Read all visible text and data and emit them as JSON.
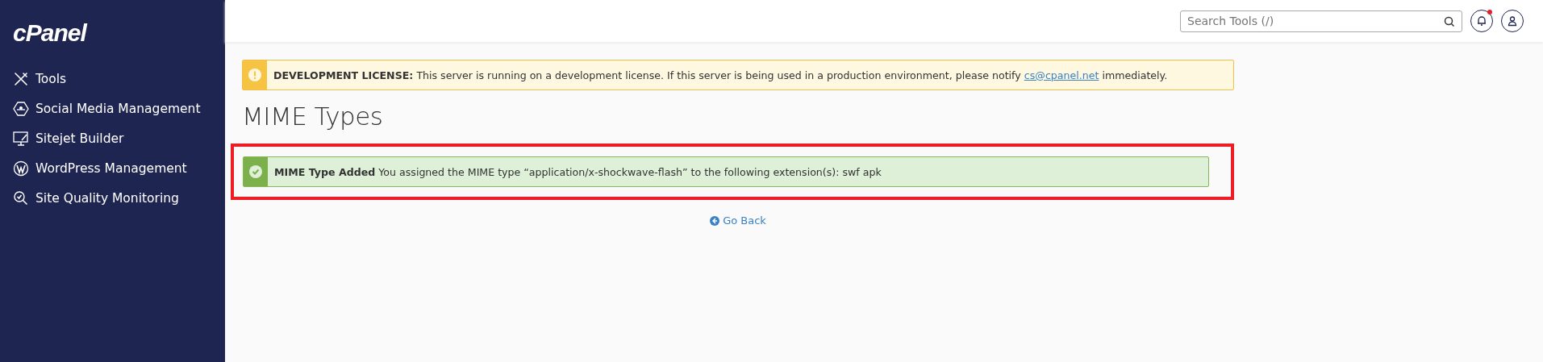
{
  "sidebar": {
    "logo": "cPanel",
    "items": [
      {
        "label": "Tools"
      },
      {
        "label": "Social Media Management"
      },
      {
        "label": "Sitejet Builder"
      },
      {
        "label": "WordPress Management"
      },
      {
        "label": "Site Quality Monitoring"
      }
    ]
  },
  "header": {
    "search": {
      "placeholder": "Search Tools (/)"
    },
    "notifications": {
      "unread": true
    }
  },
  "license_notice": {
    "text_before": "**DEVELOPMENT LICENSE:** This server is running on a development license. If this server is being used in a production environment, please notify ",
    "link": "cs@cpanel.net",
    "text_after": " immediately."
  },
  "page_title": "MIME Types",
  "success_notice": {
    "highlighted": true,
    "text": "**MIME Type Added** You assigned the MIME type “application/x-shockwave-flash” to the following extension(s): swf apk"
  },
  "go_back": "Go Back"
}
